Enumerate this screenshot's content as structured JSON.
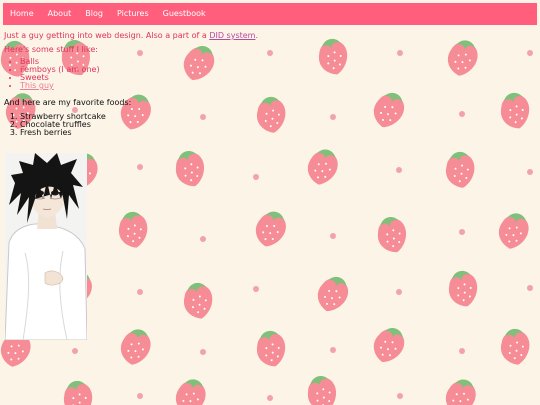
{
  "nav": {
    "items": [
      {
        "label": "Home"
      },
      {
        "label": "About"
      },
      {
        "label": "Blog"
      },
      {
        "label": "Pictures"
      },
      {
        "label": "Guestbook"
      }
    ]
  },
  "intro": {
    "text_before": "Just a guy getting into web design. Also a part of a ",
    "link_label": "DID system",
    "text_after": "."
  },
  "likes": {
    "heading": "Here's some stuff I like:",
    "items": [
      {
        "label": "Balls"
      },
      {
        "label": "Femboys (I am one)"
      },
      {
        "label": "Sweets"
      },
      {
        "label": "This guy"
      }
    ]
  },
  "foods": {
    "heading": "And here are my favorite foods:",
    "items": [
      {
        "label": "Strawberry shortcake"
      },
      {
        "label": "Chocolate truffles"
      },
      {
        "label": "Fresh berries"
      }
    ]
  },
  "colors": {
    "nav_background": "#ff5f7c",
    "page_background": "#fbf4e7",
    "accent_text": "#e0345b",
    "link": "#b54b9d",
    "strawberry": "#f58c96",
    "leaf": "#7fc07a",
    "dot": "#f2a2ad"
  },
  "icons": {
    "background_pattern": "strawberry-pattern",
    "portrait": "anime-character-portrait"
  }
}
